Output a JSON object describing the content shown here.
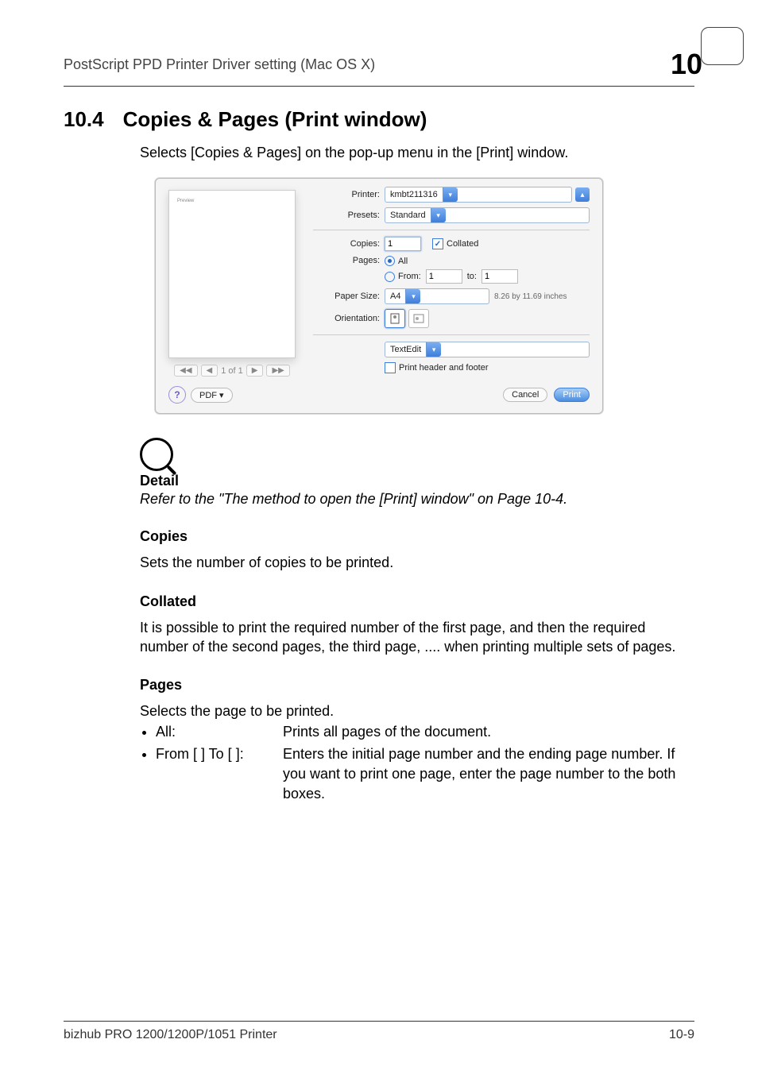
{
  "header": {
    "running_title": "PostScript PPD Printer Driver setting (Mac OS X)",
    "chapter_number": "10"
  },
  "section": {
    "number": "10.4",
    "title": "Copies & Pages (Print window)",
    "lead": "Selects [Copies & Pages] on the pop-up menu in the [Print] window."
  },
  "dialog": {
    "nav": {
      "page_indicator": "1 of 1",
      "first": "◀◀",
      "prev": "◀",
      "next": "▶",
      "last": "▶▶"
    },
    "labels": {
      "printer": "Printer:",
      "presets": "Presets:",
      "copies": "Copies:",
      "collated": "Collated",
      "pages": "Pages:",
      "all": "All",
      "from": "From:",
      "to": "to:",
      "paper_size": "Paper Size:",
      "paper_note": "8.26 by 11.69 inches",
      "orientation": "Orientation:",
      "panel": "TextEdit",
      "print_hf": "Print header and footer",
      "pdf": "PDF ▾",
      "cancel": "Cancel",
      "print": "Print"
    },
    "values": {
      "printer": "kmbt211316",
      "presets": "Standard",
      "copies": "1",
      "from": "1",
      "to": "1",
      "paper_size": "A4"
    }
  },
  "detail": {
    "label": "Detail",
    "text": "Refer to the \"The method to open the [Print] window\" on Page 10-4."
  },
  "copies": {
    "heading": "Copies",
    "body": "Sets the number of copies to be printed."
  },
  "collated": {
    "heading": "Collated",
    "body": "It is possible to print the required number of the first page, and then the required number of the second pages, the third page, .... when printing multiple sets of pages."
  },
  "pages": {
    "heading": "Pages",
    "lead": "Selects the page to be printed.",
    "items": [
      {
        "key": "All:",
        "val": "Prints all pages of the document."
      },
      {
        "key": "From [   ] To [   ]:",
        "val": "Enters the initial page number and the ending page number. If you want to print one page, enter the page number to the both boxes."
      }
    ]
  },
  "footer": {
    "left": "bizhub PRO 1200/1200P/1051 Printer",
    "right": "10-9"
  }
}
